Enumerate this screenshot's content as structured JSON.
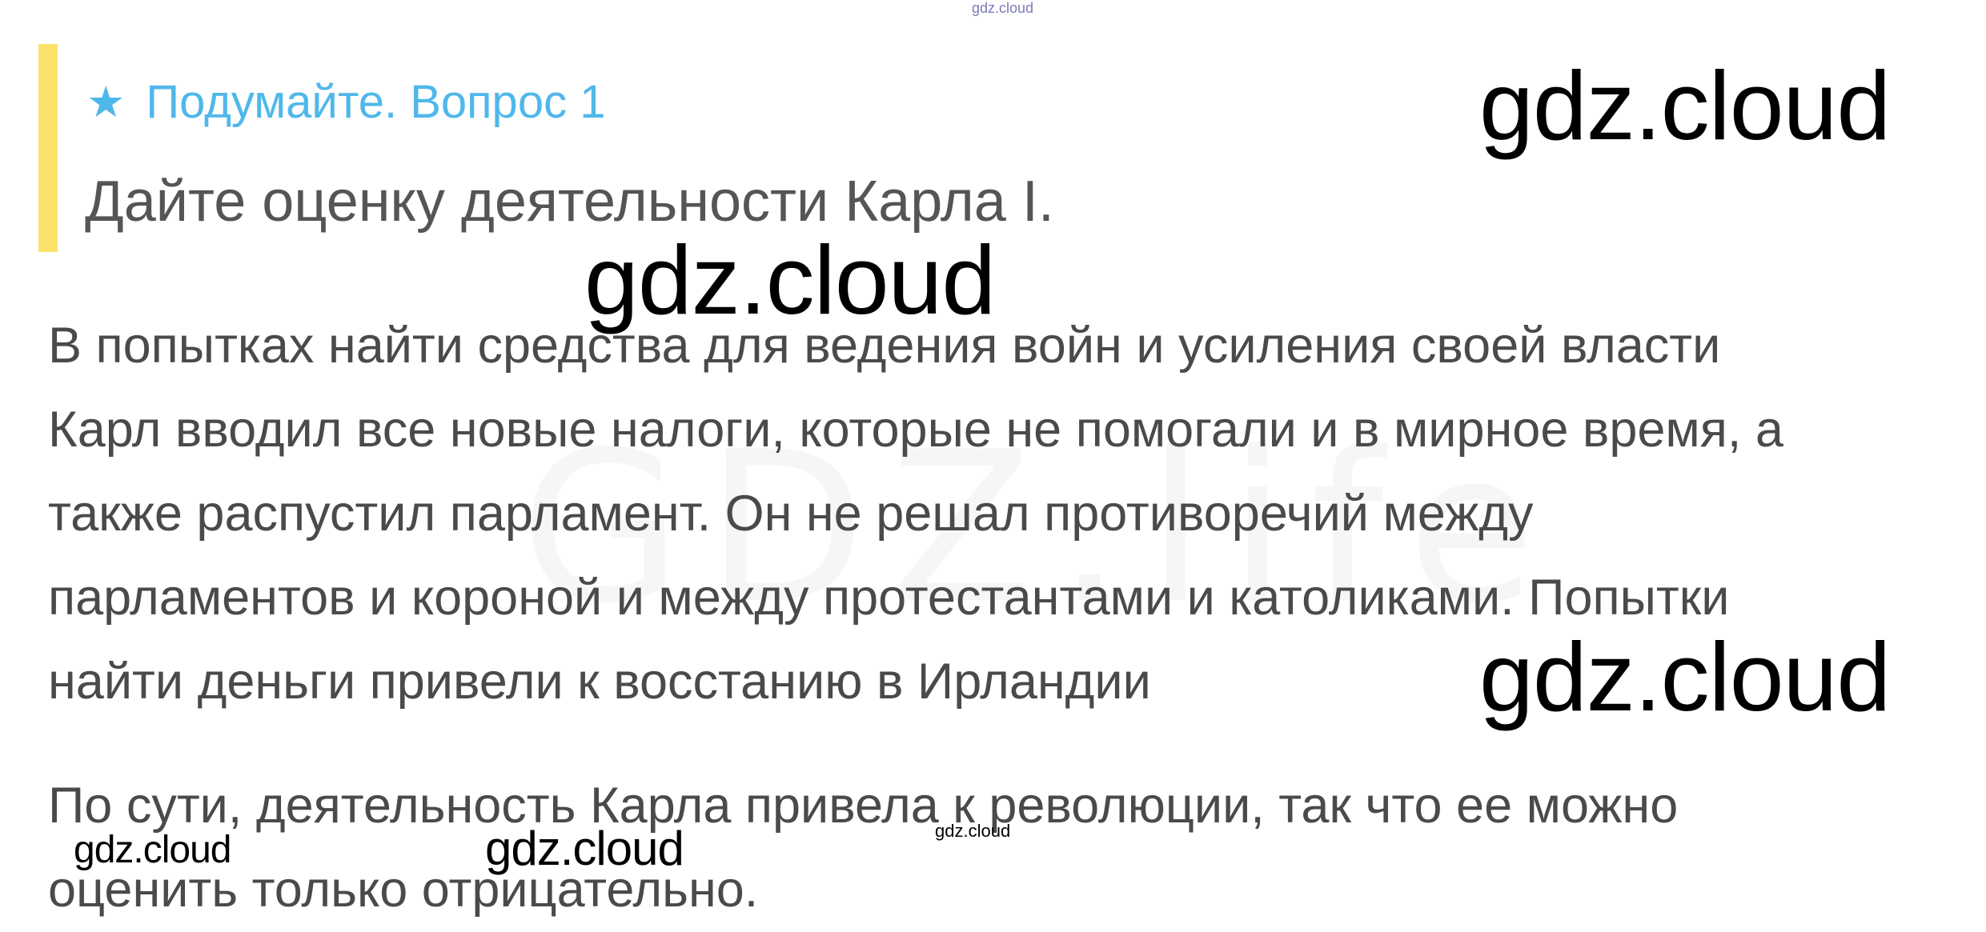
{
  "question": {
    "heading": "Подумайте. Вопрос 1",
    "text": "Дайте оценку деятельности Карла I.",
    "accent_color": "#fbe26a",
    "heading_color": "#4fb8ea",
    "icon": "star-icon"
  },
  "answer": {
    "paragraph1_lines": [
      "В попытках найти средства для ведения войн и усиления своей власти",
      "Карл вводил все новые налоги, которые не помогали и в мирное время, а",
      "также распустил парламент. Он не решал противоречий между",
      "парламентов и короной и между протестантами и католиками. Попытки",
      "найти деньги привели к восстанию в Ирландии"
    ],
    "paragraph2_lines": [
      "По сути, деятельность Карла привела к революции, так что ее можно",
      "оценить только отрицательно."
    ]
  },
  "watermarks": {
    "top_small": "gdz.cloud",
    "big_1": "gdz.cloud",
    "big_2": "gdz.cloud",
    "big_3": "gdz.cloud",
    "mid_1": "gdz.cloud",
    "mid_2": "gdz.cloud",
    "small_1": "gdz.cloud",
    "ghost": "GDZ.life"
  }
}
